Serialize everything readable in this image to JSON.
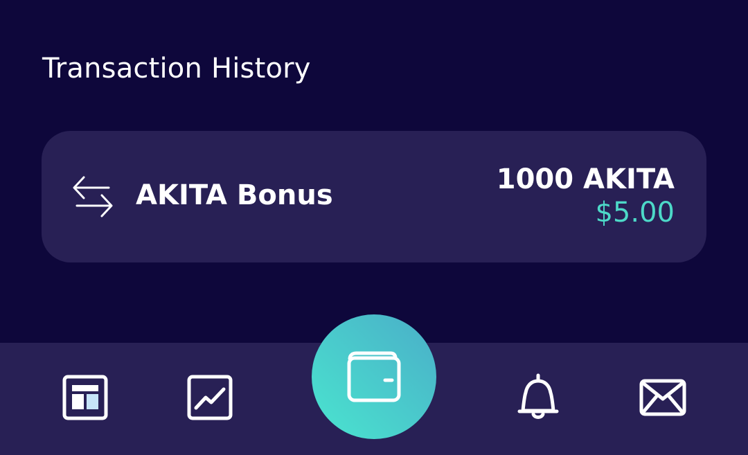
{
  "section": {
    "title": "Transaction History"
  },
  "transactions": [
    {
      "icon": "transfer-arrows-icon",
      "name": "AKITA Bonus",
      "amount_crypto": "1000 AKITA",
      "amount_fiat": "$5.00"
    }
  ],
  "bottom_nav": {
    "items": [
      {
        "icon": "dashboard-icon"
      },
      {
        "icon": "chart-line-icon"
      },
      {
        "icon": "wallet-icon",
        "active": true
      },
      {
        "icon": "bell-icon"
      },
      {
        "icon": "mail-icon"
      }
    ]
  },
  "colors": {
    "background": "#0e073b",
    "card": "#282055",
    "accent_teal": "#4dd9c8",
    "fab_gradient_start": "#4ae5cf",
    "fab_gradient_end": "#4aaec8",
    "text": "#ffffff",
    "icon_highlight": "#c6e4f8"
  }
}
